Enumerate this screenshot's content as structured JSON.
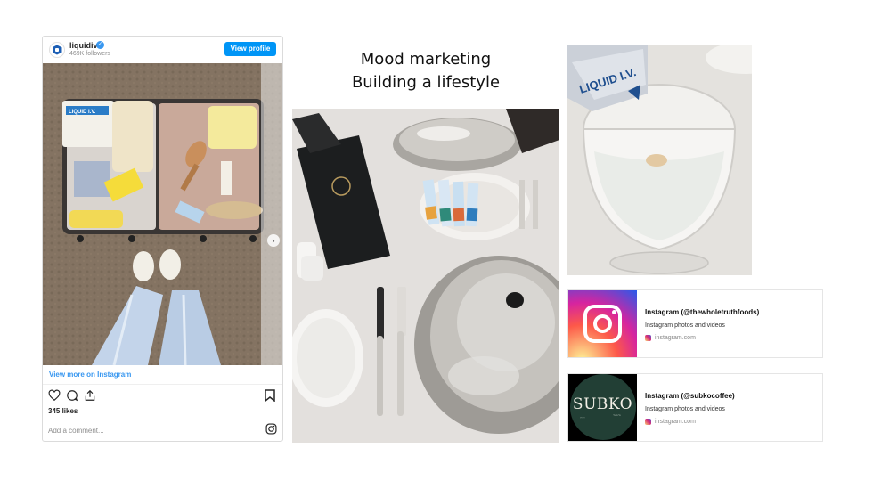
{
  "slide": {
    "title_line1": "Mood marketing",
    "title_line2": "Building a lifestyle"
  },
  "instagram_embed": {
    "username": "liquidiv",
    "followers": "469K followers",
    "view_profile_label": "View profile",
    "view_more_label": "View more on Instagram",
    "likes": "345 likes",
    "comment_placeholder": "Add a comment...",
    "photo_brand_text": "LIQUID I.V.",
    "icons": [
      "heart-icon",
      "comment-icon",
      "share-icon",
      "bookmark-icon",
      "instagram-icon",
      "chevron-right-icon"
    ]
  },
  "link_cards": [
    {
      "title": "Instagram (@thewholetruthfoods)",
      "description": "Instagram photos and videos",
      "domain": "instagram.com"
    },
    {
      "title": "Instagram (@subkocoffee)",
      "description": "Instagram photos and videos",
      "domain": "instagram.com",
      "thumbnail_text": "SUBKO"
    }
  ],
  "photos": {
    "glass_brand_text": "LIQUID I.V."
  },
  "colors": {
    "instagram_blue": "#0095f6",
    "link_blue": "#3897f0",
    "subko_green": "#223f35"
  }
}
